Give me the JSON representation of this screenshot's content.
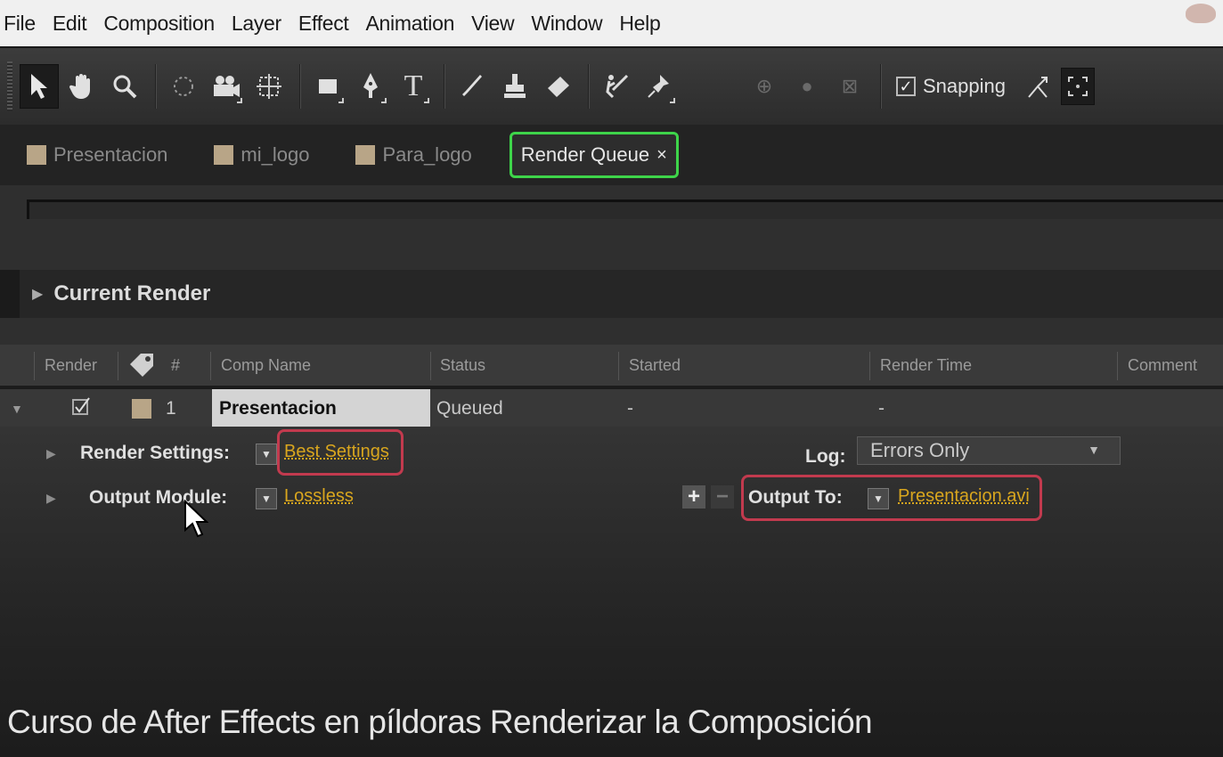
{
  "menu": [
    "File",
    "Edit",
    "Composition",
    "Layer",
    "Effect",
    "Animation",
    "View",
    "Window",
    "Help"
  ],
  "toolbar": {
    "snapping_label": "Snapping",
    "snapping_checked": true,
    "tools": [
      "selection-tool-icon",
      "hand-tool-icon",
      "zoom-tool-icon",
      "rotation-tool-icon",
      "camera-tool-icon",
      "pan-behind-tool-icon",
      "rectangle-tool-icon",
      "pen-tool-icon",
      "type-tool-icon",
      "brush-tool-icon",
      "clone-stamp-tool-icon",
      "eraser-tool-icon",
      "roto-brush-tool-icon",
      "puppet-pin-tool-icon"
    ]
  },
  "tabs": [
    {
      "label": "Presentacion",
      "active": false
    },
    {
      "label": "mi_logo",
      "active": false
    },
    {
      "label": "Para_logo",
      "active": false
    },
    {
      "label": "Render Queue",
      "active": true,
      "close": "×"
    }
  ],
  "current_render": {
    "label": "Current Render"
  },
  "queue_header": {
    "render": "Render",
    "number": "#",
    "comp_name": "Comp Name",
    "status": "Status",
    "started": "Started",
    "render_time": "Render Time",
    "comment": "Comment"
  },
  "queue_item": {
    "index": "1",
    "comp_name": "Presentacion",
    "status": "Queued",
    "started": "-",
    "render_time": "-",
    "checked": true
  },
  "render_settings": {
    "label": "Render Settings:",
    "value": "Best Settings"
  },
  "output_module": {
    "label": "Output Module:",
    "value": "Lossless"
  },
  "log": {
    "label": "Log:",
    "value": "Errors Only"
  },
  "output_to": {
    "label": "Output To:",
    "value": "Presentacion.avi"
  },
  "caption": "Curso de After Effects en píldoras Renderizar la Composición",
  "colors": {
    "accent_link": "#d9a61e",
    "highlight_green": "#3ed44a",
    "highlight_red": "#c23a4e",
    "label_swatch": "#b8a587"
  }
}
